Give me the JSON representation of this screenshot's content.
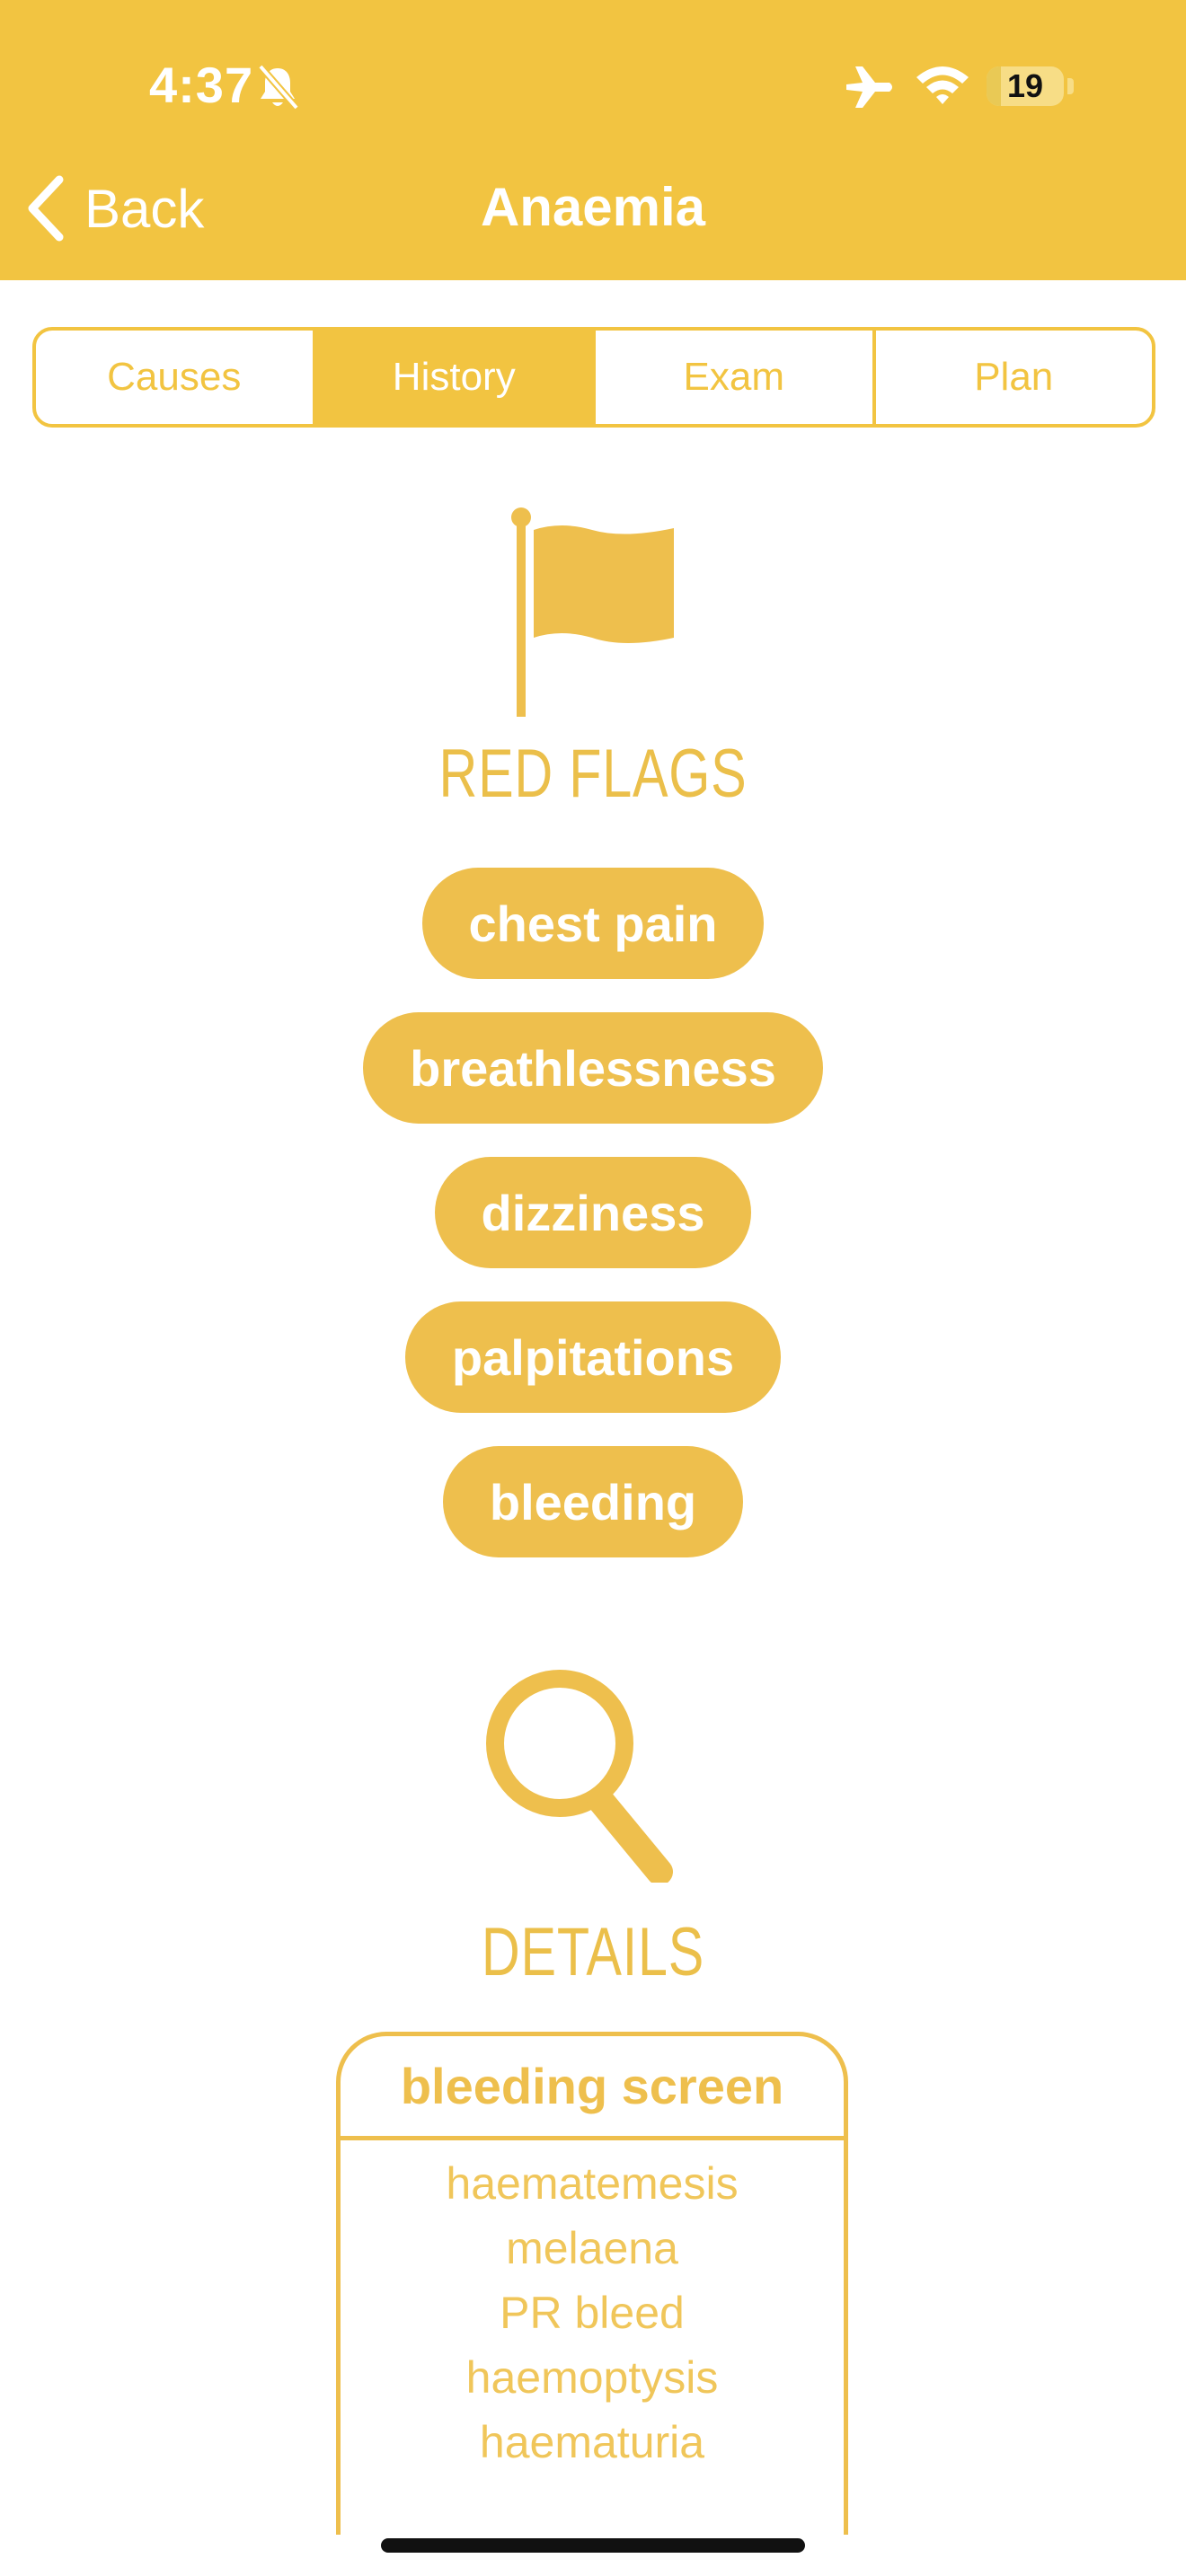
{
  "status_bar": {
    "time": "4:37",
    "battery_level": "19",
    "battery_fraction": 0.19,
    "icons": [
      "bell-slash-icon",
      "airplane-icon",
      "wifi-icon",
      "battery-icon"
    ]
  },
  "nav": {
    "back_label": "Back",
    "title": "Anaemia"
  },
  "tabs": [
    {
      "label": "Causes",
      "active": false
    },
    {
      "label": "History",
      "active": true
    },
    {
      "label": "Exam",
      "active": false
    },
    {
      "label": "Plan",
      "active": false
    }
  ],
  "red_flags": {
    "icon": "flag-icon",
    "title": "RED FLAGS",
    "items": [
      "chest pain",
      "breathlessness",
      "dizziness",
      "palpitations",
      "bleeding"
    ]
  },
  "details": {
    "icon": "magnifying-glass-icon",
    "title": "DETAILS",
    "card": {
      "title": "bleeding screen",
      "items": [
        "haematemesis",
        "melaena",
        "PR bleed",
        "haemoptysis",
        "haematuria"
      ]
    }
  },
  "colors": {
    "header": "#F2C441",
    "accent": "#EEBF4D",
    "light_text": "#F0C65A",
    "white": "#FFFFFF"
  }
}
